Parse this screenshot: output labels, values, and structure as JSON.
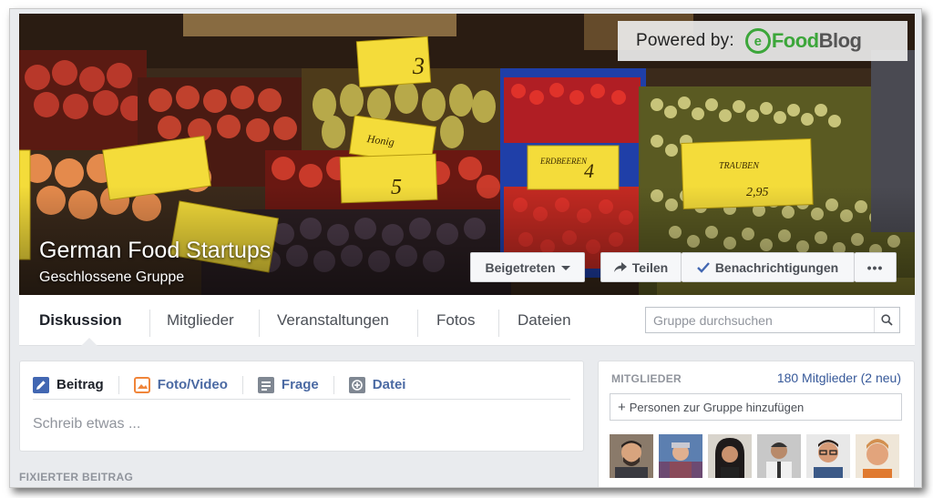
{
  "cover": {
    "powered_text": "Powered by:",
    "logo_mark": "e",
    "logo_prefix": "Food",
    "logo_suffix": "Blog",
    "title": "German Food Startups",
    "subtitle": "Geschlossene Gruppe",
    "price_tags": [
      "3",
      "Honig",
      "4",
      "2,95",
      "5",
      "ERDBEEREN",
      "TRAUBEN"
    ]
  },
  "actions": {
    "joined": "Beigetreten",
    "share": "Teilen",
    "notifications": "Benachrichtigungen",
    "more": "•••"
  },
  "tabs": [
    {
      "label": "Diskussion",
      "active": true
    },
    {
      "label": "Mitglieder"
    },
    {
      "label": "Veranstaltungen"
    },
    {
      "label": "Fotos"
    },
    {
      "label": "Dateien"
    }
  ],
  "search": {
    "placeholder": "Gruppe durchsuchen"
  },
  "composer": {
    "tabs": [
      "Beitrag",
      "Foto/Video",
      "Frage",
      "Datei"
    ],
    "placeholder": "Schreib etwas ..."
  },
  "pinned_label": "FIXIERTER BEITRAG",
  "members": {
    "heading": "MITGLIEDER",
    "count": "180 Mitglieder (2 neu)",
    "add_label": "Personen zur Gruppe hinzufügen"
  },
  "colors": {
    "link": "#365899",
    "tab_blue": "#4b6aa3",
    "logo_green": "#3ca63a",
    "check_blue": "#4267b2"
  }
}
